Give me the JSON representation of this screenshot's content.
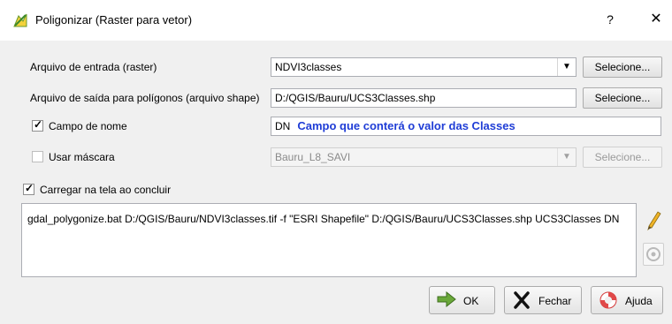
{
  "window": {
    "title": "Poligonizar (Raster para vetor)",
    "help_label": "?",
    "close_label": "✕"
  },
  "input_raster": {
    "label": "Arquivo de entrada (raster)",
    "value": "NDVI3classes",
    "browse_label": "Selecione..."
  },
  "output_shape": {
    "label": "Arquivo de saída para polígonos (arquivo shape)",
    "value": "D:/QGIS/Bauru/UCS3Classes.shp",
    "browse_label": "Selecione..."
  },
  "field_name": {
    "label": "Campo de nome",
    "checked": true,
    "value": "DN",
    "annotation": "Campo que conterá o valor das Classes",
    "annotation_color": "#1f3dd6"
  },
  "mask": {
    "label": "Usar máscara",
    "checked": false,
    "value": "Bauru_L8_SAVI",
    "browse_label": "Selecione..."
  },
  "load_on_finish": {
    "label": "Carregar na tela ao concluir",
    "checked": true
  },
  "command": {
    "text": "gdal_polygonize.bat D:/QGIS/Bauru/NDVI3classes.tif -f \"ESRI Shapefile\" D:/QGIS/Bauru/UCS3Classes.shp UCS3Classes DN"
  },
  "side_icons": [
    "edit-pencil-icon",
    "reset-icon"
  ],
  "buttons": {
    "ok": "OK",
    "close": "Fechar",
    "help": "Ajuda"
  }
}
